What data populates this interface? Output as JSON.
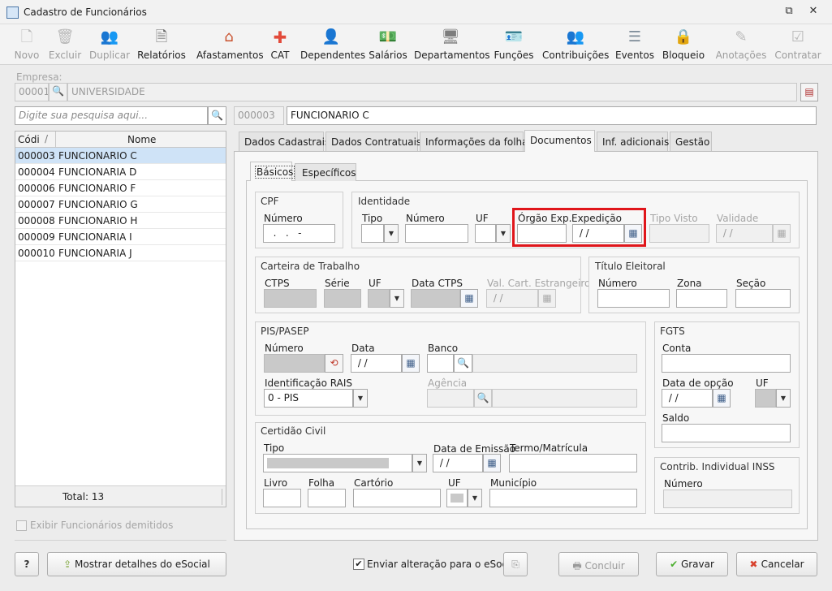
{
  "window": {
    "title": "Cadastro de Funcionários"
  },
  "toolbar": {
    "items": [
      {
        "label": "Novo",
        "icon": "new-document-icon",
        "enabled": false
      },
      {
        "label": "Excluir",
        "icon": "trash-icon",
        "enabled": false
      },
      {
        "label": "Duplicar",
        "icon": "users-icon",
        "enabled": false
      },
      {
        "label": "Relatórios",
        "icon": "report-icon",
        "enabled": true
      },
      {
        "label": "Afastamentos",
        "icon": "house-arrow-icon",
        "enabled": true
      },
      {
        "label": "CAT",
        "icon": "red-cross-icon",
        "enabled": true
      },
      {
        "label": "Dependentes",
        "icon": "people-icon",
        "enabled": true
      },
      {
        "label": "Salários",
        "icon": "money-icon",
        "enabled": true
      },
      {
        "label": "Departamentos",
        "icon": "desk-icon",
        "enabled": true
      },
      {
        "label": "Funções",
        "icon": "badge-icon",
        "enabled": true
      },
      {
        "label": "Contribuições",
        "icon": "coins-people-icon",
        "enabled": true
      },
      {
        "label": "Eventos",
        "icon": "list-icon",
        "enabled": true
      },
      {
        "label": "Bloqueio",
        "icon": "lock-icon",
        "enabled": true
      },
      {
        "label": "Anotações",
        "icon": "notes-icon",
        "enabled": false
      },
      {
        "label": "Contratar",
        "icon": "contract-icon",
        "enabled": false
      }
    ]
  },
  "empresa": {
    "label": "Empresa:",
    "code": "00001",
    "name": "UNIVERSIDADE"
  },
  "search": {
    "placeholder": "Digite sua pesquisa aqui..."
  },
  "current": {
    "code": "000003",
    "name": "FUNCIONARIO C"
  },
  "list": {
    "col_code": "Códi",
    "col_sort": "/",
    "col_name": "Nome",
    "rows": [
      {
        "code": "000003",
        "name": "FUNCIONARIO C"
      },
      {
        "code": "000004",
        "name": "FUNCIONARIA D"
      },
      {
        "code": "000006",
        "name": "FUNCIONARIO F"
      },
      {
        "code": "000007",
        "name": "FUNCIONARIO G"
      },
      {
        "code": "000008",
        "name": "FUNCIONARIO H"
      },
      {
        "code": "000009",
        "name": "FUNCIONARIA I"
      },
      {
        "code": "000010",
        "name": "FUNCIONARIA J"
      }
    ],
    "total": "Total: 13"
  },
  "show_dismissed": "Exibir Funcionários demitidos",
  "tabs": [
    "Dados Cadastrais",
    "Dados Contratuais",
    "Informações da folha",
    "Documentos",
    "Inf. adicionais",
    "Gestão"
  ],
  "subtabs": [
    "Básicos",
    "Específicos"
  ],
  "cpf": {
    "title": "CPF",
    "numero_label": "Número",
    "numero_value": "  .   .   -"
  },
  "identidade": {
    "title": "Identidade",
    "tipo": "Tipo",
    "numero": "Número",
    "uf": "UF",
    "orgao": "Órgão Exp.",
    "expedicao": "Expedição",
    "expedicao_value": " / /",
    "tipo_visto": "Tipo Visto",
    "validade": "Validade",
    "validade_value": " / /"
  },
  "ctps": {
    "title": "Carteira de Trabalho",
    "ctps": "CTPS",
    "serie": "Série",
    "uf": "UF",
    "data": "Data CTPS",
    "val": "Val. Cart. Estrangeiro",
    "val_value": " / /"
  },
  "titulo": {
    "title": "Título Eleitoral",
    "numero": "Número",
    "zona": "Zona",
    "secao": "Seção"
  },
  "pis": {
    "title": "PIS/PASEP",
    "numero": "Número",
    "data": "Data",
    "data_value": " / /",
    "banco": "Banco",
    "rais": "Identificação RAIS",
    "rais_value": "0 - PIS",
    "agencia": "Agência"
  },
  "fgts": {
    "title": "FGTS",
    "conta": "Conta",
    "data_opcao": "Data de opção",
    "data_value": " / /",
    "uf": "UF",
    "saldo": "Saldo"
  },
  "certidao": {
    "title": "Certidão Civil",
    "tipo": "Tipo",
    "emissao": "Data de Emissão",
    "emissao_value": " / /",
    "termo": "Termo/Matrícula",
    "livro": "Livro",
    "folha": "Folha",
    "cartorio": "Cartório",
    "uf": "UF",
    "municipio": "Município"
  },
  "inss": {
    "title": "Contrib. Individual INSS",
    "numero": "Número"
  },
  "footer": {
    "help": "?",
    "esocial": "Mostrar detalhes do eSocial",
    "enviar": "Enviar alteração para o eSocial",
    "concluir": "Concluir",
    "gravar": "Gravar",
    "cancelar": "Cancelar"
  },
  "highlight_color": "#e0161b"
}
